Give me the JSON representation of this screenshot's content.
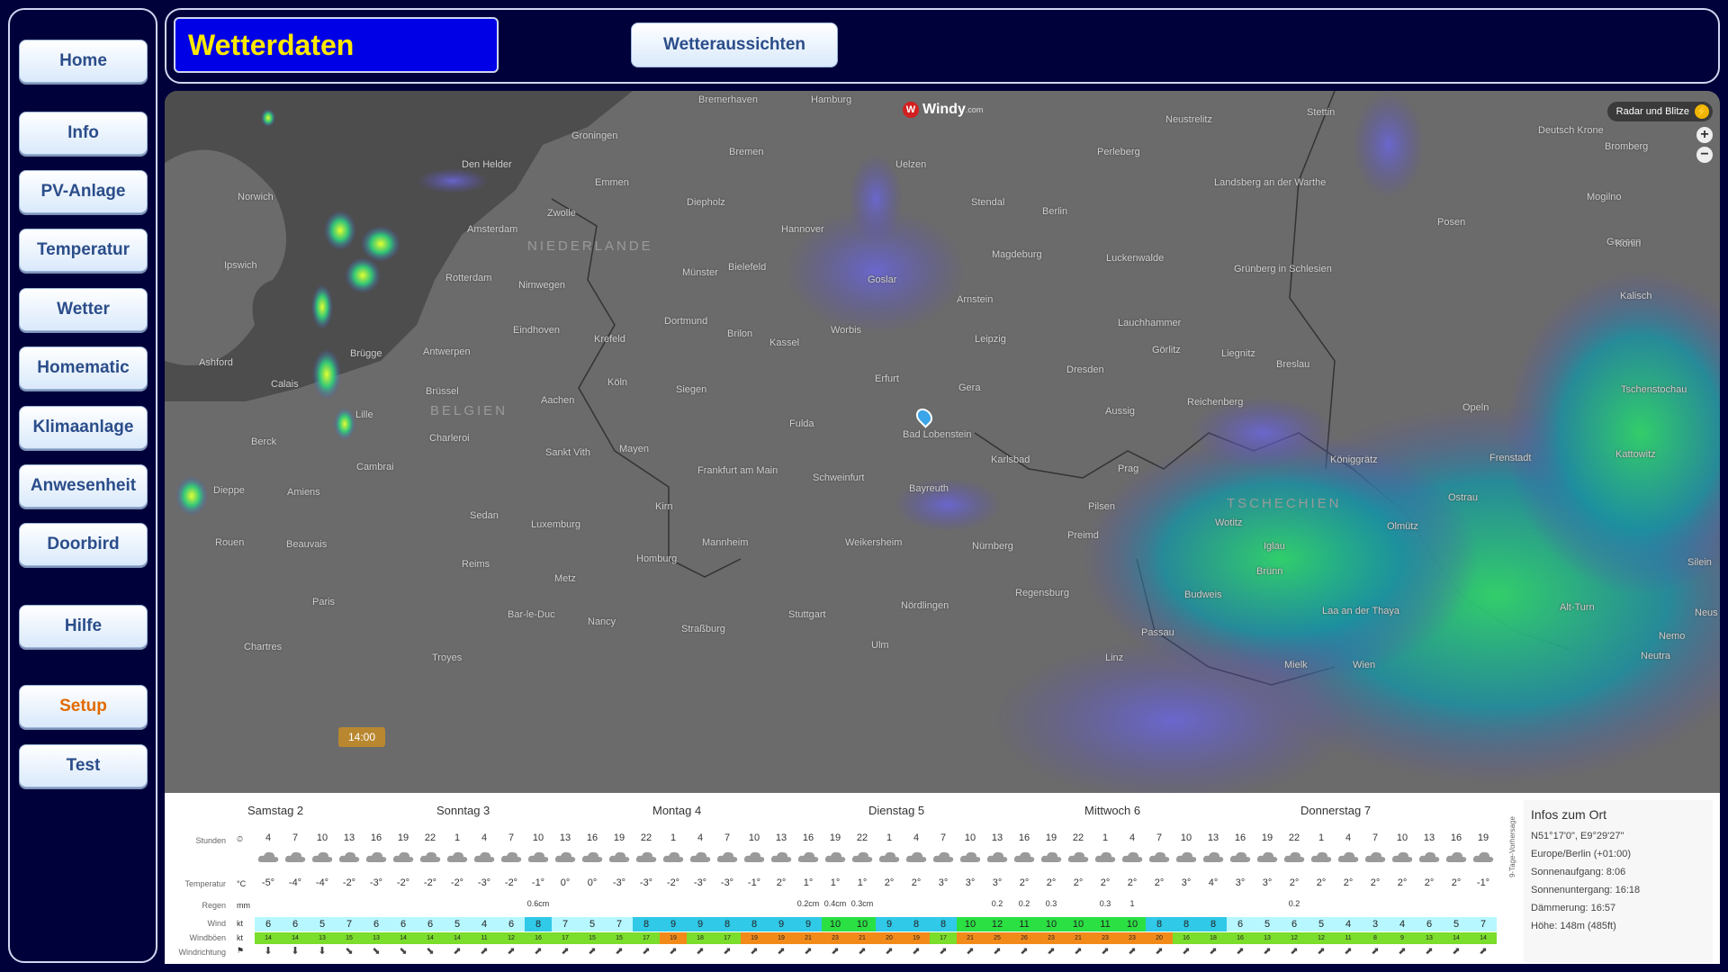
{
  "sidebar": {
    "items": [
      {
        "label": "Home"
      },
      {
        "label": "Info"
      },
      {
        "label": "PV-Anlage"
      },
      {
        "label": "Temperatur"
      },
      {
        "label": "Wetter"
      },
      {
        "label": "Homematic"
      },
      {
        "label": "Klimaanlage"
      },
      {
        "label": "Anwesenheit"
      },
      {
        "label": "Doorbird"
      },
      {
        "label": "Hilfe"
      },
      {
        "label": "Setup"
      },
      {
        "label": "Test"
      }
    ]
  },
  "header": {
    "title": "Wetterdaten",
    "forecast_button": "Wetteraussichten"
  },
  "map": {
    "logo": "Windy",
    "logo_suffix": ".com",
    "layer_button": "Radar und Blitze",
    "zoom_in": "+",
    "zoom_out": "−",
    "time_marker": "14:00",
    "countries": [
      "NIEDERLANDE",
      "BELGIEN",
      "TSCHECHIEN"
    ],
    "cities": [
      "Bremerhaven",
      "Hamburg",
      "Neustrelitz",
      "Stettin",
      "Deutsch Krone",
      "Bromberg",
      "Groningen",
      "Bremen",
      "Uelzen",
      "Perleberg",
      "Den Helder",
      "Emmen",
      "Diepholz",
      "Stendal",
      "Landsberg an der Warthe",
      "Berlin",
      "Zwolle",
      "Hannover",
      "Posen",
      "Amsterdam",
      "Magdeburg",
      "Luckenwalde",
      "Gnesen",
      "Grünberg in Schlesien",
      "Goslar",
      "Rotterdam",
      "Nimwegen",
      "Münster",
      "Bielefeld",
      "Arnstein",
      "Lauchhammer",
      "Dortmund",
      "Eindhoven",
      "Krefeld",
      "Brilon",
      "Kassel",
      "Worbis",
      "Leipzig",
      "Antwerpen",
      "Brügge",
      "Görlitz",
      "Liegnitz",
      "Breslau",
      "Köln",
      "Erfurt",
      "Gera",
      "Dresden",
      "Brüssel",
      "Siegen",
      "Aachen",
      "Aussig",
      "Reichenberg",
      "Lille",
      "Fulda",
      "Bad Lobenstein",
      "Karlsbad",
      "Königgrätz",
      "Charleroi",
      "Sankt Vith",
      "Mayen",
      "Frankfurt am Main",
      "Schweinfurt",
      "Bayreuth",
      "Prag",
      "Pilsen",
      "Ostrau",
      "Amiens",
      "Cambrai",
      "Luxemburg",
      "Kirn",
      "Sedan",
      "Mannheim",
      "Weikersheim",
      "Nürnberg",
      "Preimd",
      "Wotitz",
      "Iglau",
      "Olmütz",
      "Homburg",
      "Metz",
      "Reims",
      "Rouen",
      "Beauvais",
      "Paris",
      "Brünn",
      "Budweis",
      "Regensburg",
      "Stuttgart",
      "Nördlingen",
      "Straßburg",
      "Nancy",
      "Bar-le-Duc",
      "Chartres",
      "Troyes",
      "Passau",
      "Linz",
      "Ulm",
      "Norwich",
      "Ipswich",
      "Ashford",
      "Calais",
      "Dieppe",
      "Berck",
      "Laa an der Thaya",
      "Opeln",
      "Frenstadt",
      "Kattowitz",
      "Tschenstochau",
      "Konin",
      "Kalisch",
      "Mogilno",
      "Mielk",
      "Wien",
      "Alt-Turn",
      "Nemo",
      "Neutra",
      "Neus",
      "Silein"
    ]
  },
  "forecast": {
    "days": [
      "Samstag 2",
      "Sonntag 3",
      "Montag 4",
      "Dienstag 5",
      "Mittwoch 6",
      "Donnerstag 7"
    ],
    "row_labels": {
      "hours": "Stunden",
      "temperature": "Temperatur",
      "rain": "Regen",
      "wind": "Wind",
      "gusts": "Windböen",
      "direction": "Windrichtung"
    },
    "units": {
      "temperature": "°C",
      "rain": "mm",
      "wind": "kt",
      "gusts": "kt"
    },
    "hours": [
      "4",
      "7",
      "10",
      "13",
      "16",
      "19",
      "22",
      "1",
      "4",
      "7",
      "10",
      "13",
      "16",
      "19",
      "22",
      "1",
      "4",
      "7",
      "10",
      "13",
      "16",
      "19",
      "22",
      "1",
      "4",
      "7",
      "10",
      "13",
      "16",
      "19",
      "22",
      "1",
      "4",
      "7",
      "10",
      "13",
      "16",
      "19",
      "22",
      "1",
      "4",
      "7",
      "10",
      "13",
      "16",
      "19"
    ],
    "temperatures": [
      "-5°",
      "-4°",
      "-4°",
      "-2°",
      "-3°",
      "-2°",
      "-2°",
      "-2°",
      "-3°",
      "-2°",
      "-1°",
      "0°",
      "0°",
      "-3°",
      "-3°",
      "-2°",
      "-3°",
      "-3°",
      "-1°",
      "2°",
      "1°",
      "1°",
      "1°",
      "2°",
      "2°",
      "3°",
      "3°",
      "3°",
      "2°",
      "2°",
      "2°",
      "2°",
      "2°",
      "2°",
      "3°",
      "4°",
      "3°",
      "3°",
      "2°",
      "2°",
      "2°",
      "2°",
      "2°",
      "2°",
      "2°",
      "-1°"
    ],
    "rain": [
      "",
      "",
      "",
      "",
      "",
      "",
      "",
      "",
      "",
      "",
      "0.6cm",
      "",
      "",
      "",
      "",
      "",
      "",
      "",
      "",
      "",
      "0.2cm",
      "0.4cm",
      "0.3cm",
      "",
      "",
      "",
      "",
      "0.2",
      "0.2",
      "0.3",
      "",
      "0.3",
      "1",
      "",
      "",
      "",
      "",
      "",
      "0.2",
      "",
      "",
      "",
      "",
      "",
      "",
      ""
    ],
    "wind": [
      "6",
      "6",
      "5",
      "7",
      "6",
      "6",
      "6",
      "5",
      "4",
      "6",
      "8",
      "7",
      "5",
      "7",
      "8",
      "9",
      "9",
      "8",
      "8",
      "9",
      "9",
      "10",
      "10",
      "9",
      "8",
      "8",
      "10",
      "12",
      "11",
      "10",
      "10",
      "11",
      "10",
      "8",
      "8",
      "8",
      "6",
      "5",
      "6",
      "5",
      "4",
      "3",
      "4",
      "6",
      "5",
      "7"
    ],
    "gusts": [
      "14",
      "14",
      "13",
      "15",
      "13",
      "14",
      "14",
      "14",
      "11",
      "12",
      "16",
      "17",
      "15",
      "15",
      "17",
      "19",
      "18",
      "17",
      "19",
      "19",
      "21",
      "23",
      "21",
      "20",
      "19",
      "17",
      "21",
      "25",
      "26",
      "23",
      "21",
      "23",
      "23",
      "20",
      "16",
      "18",
      "16",
      "13",
      "12",
      "12",
      "11",
      "8",
      "9",
      "13",
      "14",
      "14"
    ],
    "directions": [
      "⬇",
      "⬇",
      "⬇",
      "⬊",
      "⬊",
      "⬊",
      "⬊",
      "⬈",
      "⬈",
      "⬈",
      "⬈",
      "⬈",
      "⬈",
      "⬈",
      "⬈",
      "⬈",
      "⬈",
      "⬈",
      "⬈",
      "⬈",
      "⬈",
      "⬈",
      "⬈",
      "⬈",
      "⬈",
      "⬈",
      "⬈",
      "⬈",
      "⬈",
      "⬈",
      "⬈",
      "⬈",
      "⬈",
      "⬈",
      "⬈",
      "⬈",
      "⬈",
      "⬈",
      "⬈",
      "⬈",
      "⬈",
      "⬈",
      "⬈",
      "⬈",
      "⬈",
      "⬈"
    ],
    "side_label": "9-Tage-Vorhersage",
    "colors": {
      "wind_low": "#b7f7ff",
      "wind_mid": "#30c9e8",
      "wind_high": "#2be043",
      "gust_low": "#7bdd2c",
      "gust_high": "#f28a1a"
    }
  },
  "info": {
    "title": "Infos zum Ort",
    "coords": "N51°17'0\", E9°29'27\"",
    "timezone": "Europe/Berlin (+01:00)",
    "sunrise": "Sonnenaufgang: 8:06",
    "sunset": "Sonnenuntergang: 16:18",
    "dusk": "Dämmerung: 16:57",
    "altitude": "Höhe: 148m (485ft)"
  }
}
